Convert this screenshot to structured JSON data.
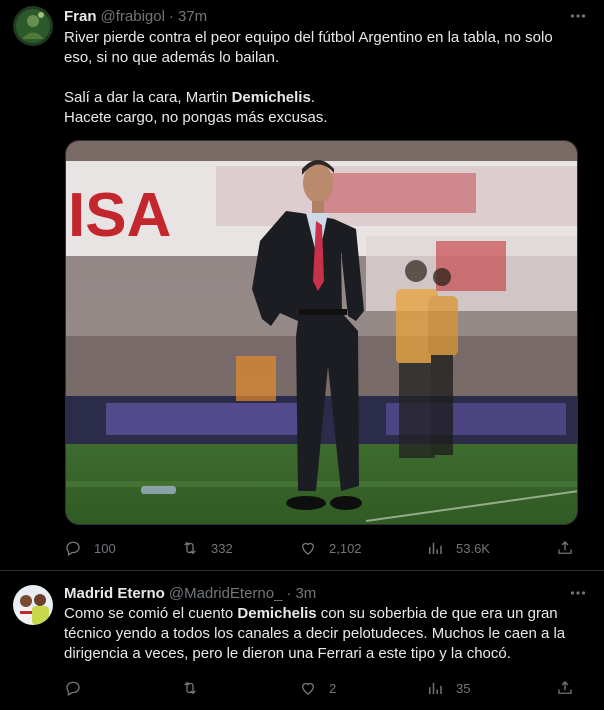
{
  "tweets": [
    {
      "name": "Fran",
      "handle": "@frabigol",
      "separator": "·",
      "time": "37m",
      "text_lines": [
        "River pierde contra el peor equipo del fútbol Argentino en la tabla, no solo",
        "eso, si no que además lo bailan.",
        "",
        "Salí a dar la cara, Martin |Demichelis|.",
        "Hacete cargo, no pongas más excusas."
      ],
      "metrics": {
        "replies": "100",
        "retweets": "332",
        "likes": "2,102",
        "views": "53.6K"
      }
    },
    {
      "name": "Madrid Eterno",
      "handle": "@MadridEterno_",
      "separator": "·",
      "time": "3m",
      "text_lines": [
        "Como se comió el cuento |Demichelis| con su soberbia de que era un gran",
        "técnico yendo a todos los canales a decir pelotudeces. Muchos le caen a la",
        "dirigencia a veces, pero le dieron una Ferrari a este tipo y la chocó."
      ],
      "metrics": {
        "replies": "",
        "retweets": "",
        "likes": "2",
        "views": "35"
      }
    }
  ],
  "media": {
    "stadium_banner_text": "ISA"
  },
  "colors": {
    "background": "#000000",
    "text": "#e7e9ea",
    "muted": "#71767b",
    "divider": "#2f3336"
  },
  "icons": [
    "more-icon",
    "reply-icon",
    "retweet-icon",
    "like-icon",
    "views-icon",
    "share-icon"
  ]
}
